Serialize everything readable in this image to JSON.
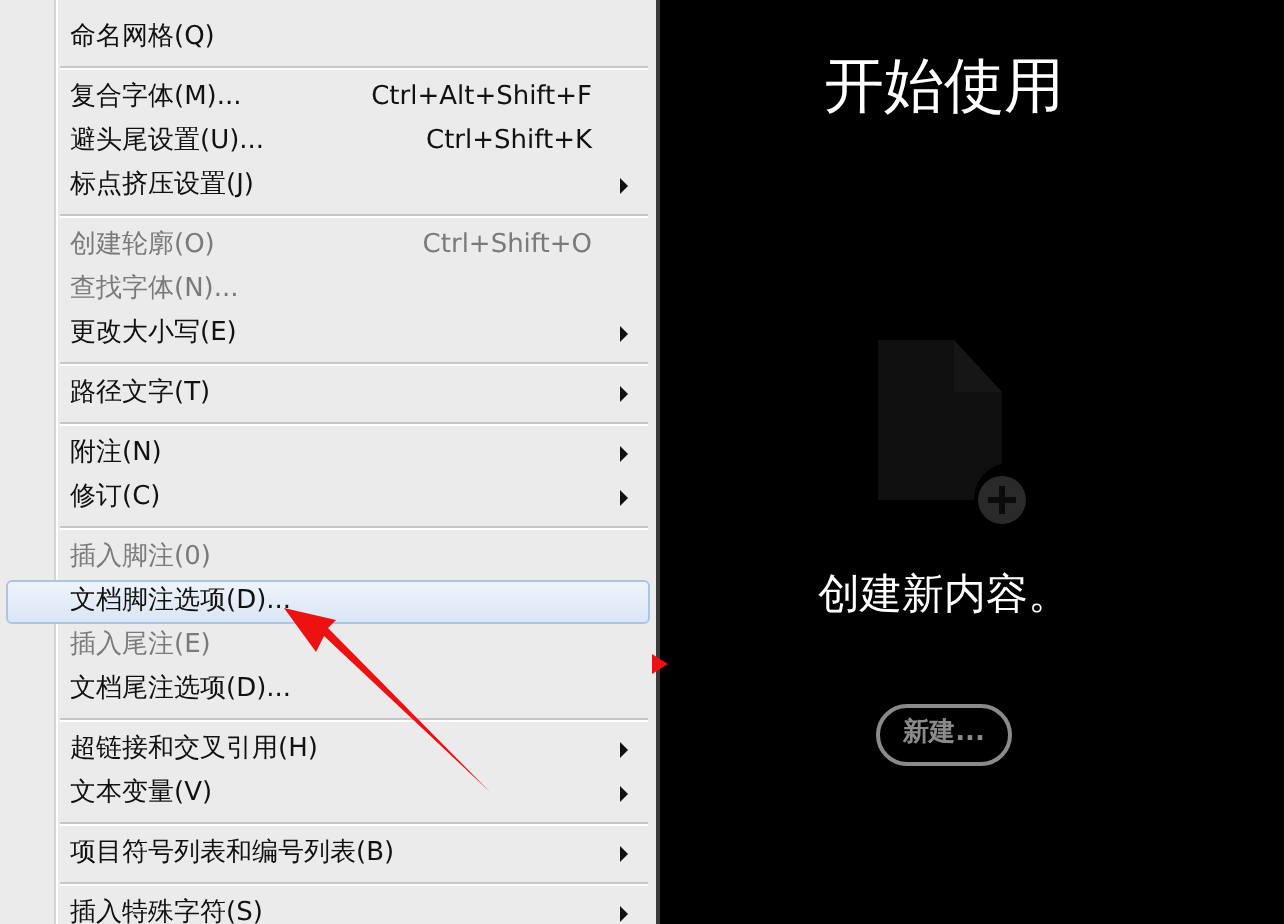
{
  "menu": {
    "items": [
      {
        "kind": "item",
        "label": "命名网格(Q)",
        "disabled": false,
        "submenu": false,
        "selected": false
      },
      {
        "kind": "separator"
      },
      {
        "kind": "item",
        "label": "复合字体(M)...",
        "shortcut": "Ctrl+Alt+Shift+F",
        "disabled": false,
        "submenu": false,
        "selected": false
      },
      {
        "kind": "item",
        "label": "避头尾设置(U)...",
        "shortcut": "Ctrl+Shift+K",
        "disabled": false,
        "submenu": false,
        "selected": false
      },
      {
        "kind": "item",
        "label": "标点挤压设置(J)",
        "disabled": false,
        "submenu": true,
        "selected": false
      },
      {
        "kind": "separator"
      },
      {
        "kind": "item",
        "label": "创建轮廓(O)",
        "shortcut": "Ctrl+Shift+O",
        "disabled": true,
        "submenu": false,
        "selected": false
      },
      {
        "kind": "item",
        "label": "查找字体(N)...",
        "disabled": true,
        "submenu": false,
        "selected": false
      },
      {
        "kind": "item",
        "label": "更改大小写(E)",
        "disabled": false,
        "submenu": true,
        "selected": false
      },
      {
        "kind": "separator"
      },
      {
        "kind": "item",
        "label": "路径文字(T)",
        "disabled": false,
        "submenu": true,
        "selected": false
      },
      {
        "kind": "separator"
      },
      {
        "kind": "item",
        "label": "附注(N)",
        "disabled": false,
        "submenu": true,
        "selected": false
      },
      {
        "kind": "item",
        "label": "修订(C)",
        "disabled": false,
        "submenu": true,
        "selected": false
      },
      {
        "kind": "separator"
      },
      {
        "kind": "item",
        "label": "插入脚注(0)",
        "disabled": true,
        "submenu": false,
        "selected": false
      },
      {
        "kind": "item",
        "label": "文档脚注选项(D)...",
        "disabled": false,
        "submenu": false,
        "selected": true
      },
      {
        "kind": "item",
        "label": "插入尾注(E)",
        "disabled": true,
        "submenu": false,
        "selected": false
      },
      {
        "kind": "item",
        "label": "文档尾注选项(D)...",
        "disabled": false,
        "submenu": false,
        "selected": false
      },
      {
        "kind": "separator"
      },
      {
        "kind": "item",
        "label": "超链接和交叉引用(H)",
        "disabled": false,
        "submenu": true,
        "selected": false
      },
      {
        "kind": "item",
        "label": "文本变量(V)",
        "disabled": false,
        "submenu": true,
        "selected": false
      },
      {
        "kind": "separator"
      },
      {
        "kind": "item",
        "label": "项目符号列表和编号列表(B)",
        "disabled": false,
        "submenu": true,
        "selected": false
      },
      {
        "kind": "separator"
      },
      {
        "kind": "item",
        "label": "插入特殊字符(S)",
        "disabled": false,
        "submenu": true,
        "selected": false
      }
    ]
  },
  "start_panel": {
    "title": "开始使用",
    "message": "创建新内容。",
    "new_button": "新建..."
  }
}
